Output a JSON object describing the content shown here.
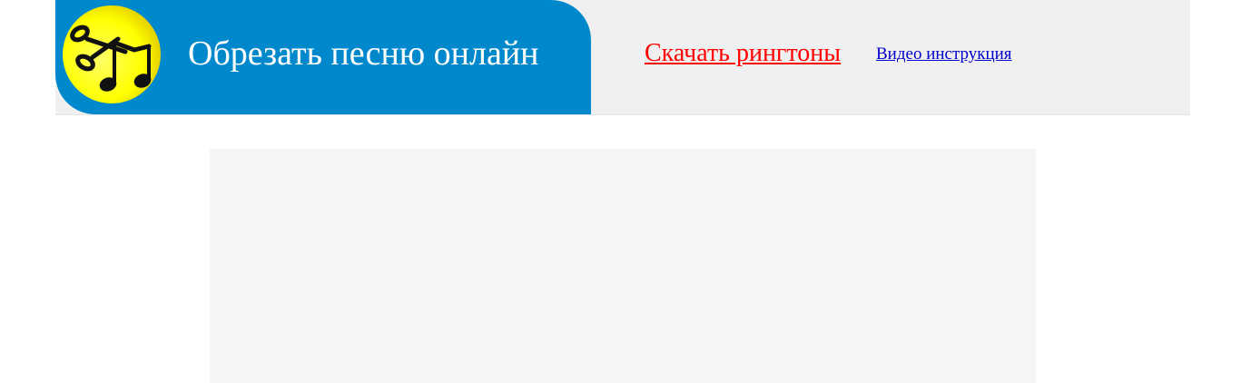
{
  "header": {
    "title": "Обрезать песню онлайн",
    "logo_icon": "scissors-music-notes-icon",
    "brand_color": "#0088cc",
    "logo_color": "#ffff00"
  },
  "nav": {
    "ringtones_label": "Скачать рингтоны",
    "ringtones_color": "#ff0000",
    "video_label": "Видео инструкция",
    "video_color": "#0000cc"
  }
}
